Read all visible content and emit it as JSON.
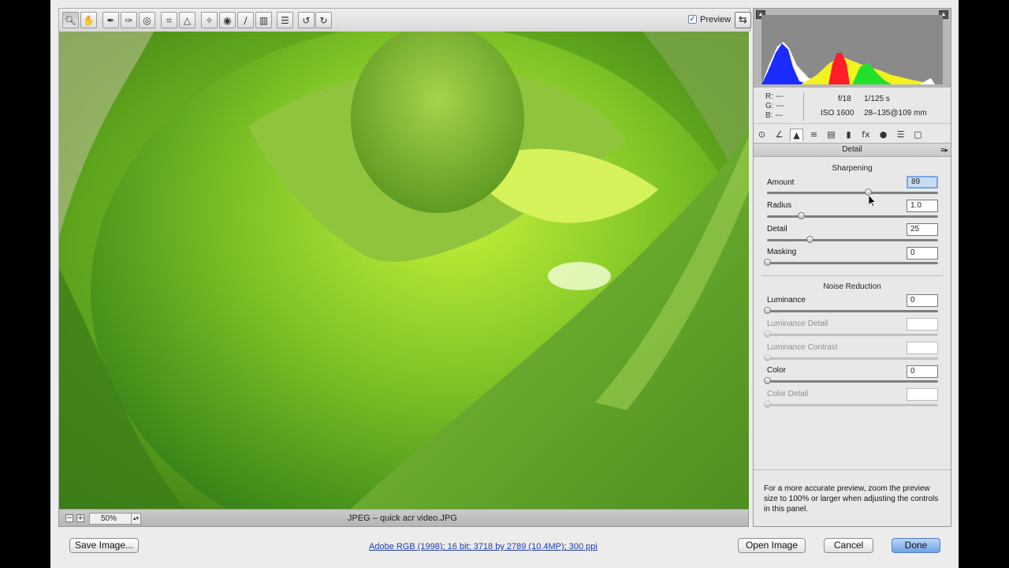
{
  "toolbar": {
    "tools": [
      "zoom-icon",
      "hand-icon",
      "white-balance-icon",
      "color-sampler-icon",
      "target-adjustment-icon",
      "crop-icon",
      "straighten-icon",
      "spot-removal-icon",
      "red-eye-icon",
      "adjustment-brush-icon",
      "graduated-filter-icon",
      "preferences-icon",
      "rotate-left-icon",
      "rotate-right-icon"
    ],
    "preview_label": "Preview",
    "preview_checked": true
  },
  "status": {
    "zoom_value": "50%",
    "filename": "JPEG  –  quick acr video.JPG"
  },
  "histogram": {
    "rgb_r": "R:  ---",
    "rgb_g": "G:  ---",
    "rgb_b": "B:  ---",
    "aperture": "f/18",
    "shutter": "1/125 s",
    "iso": "ISO 1600",
    "lens": "28–135@109 mm"
  },
  "panel": {
    "tabs": [
      "basic-icon",
      "tone-curve-icon",
      "detail-icon",
      "hsl-icon",
      "split-toning-icon",
      "lens-corrections-icon",
      "effects-icon",
      "camera-calibration-icon",
      "presets-icon",
      "snapshots-icon"
    ],
    "title": "Detail",
    "sharpening": {
      "title": "Sharpening",
      "amount_label": "Amount",
      "amount_value": "89",
      "amount_level": 0.59,
      "radius_label": "Radius",
      "radius_value": "1.0",
      "radius_level": 0.2,
      "detail_label": "Detail",
      "detail_value": "25",
      "detail_level": 0.25,
      "masking_label": "Masking",
      "masking_value": "0",
      "masking_level": 0
    },
    "noise": {
      "title": "Noise Reduction",
      "luminance_label": "Luminance",
      "luminance_value": "0",
      "lum_detail_label": "Luminance Detail",
      "lum_detail_value": "",
      "lum_contrast_label": "Luminance Contrast",
      "lum_contrast_value": "",
      "color_label": "Color",
      "color_value": "0",
      "color_detail_label": "Color Detail",
      "color_detail_value": ""
    },
    "hint": "For a more accurate preview, zoom the preview size to 100% or larger when adjusting the controls in this panel."
  },
  "footer": {
    "save_label": "Save Image...",
    "workflow": "Adobe RGB (1998); 16 bit; 3718 by 2789 (10.4MP); 300 ppi",
    "open_label": "Open Image",
    "cancel_label": "Cancel",
    "done_label": "Done"
  }
}
